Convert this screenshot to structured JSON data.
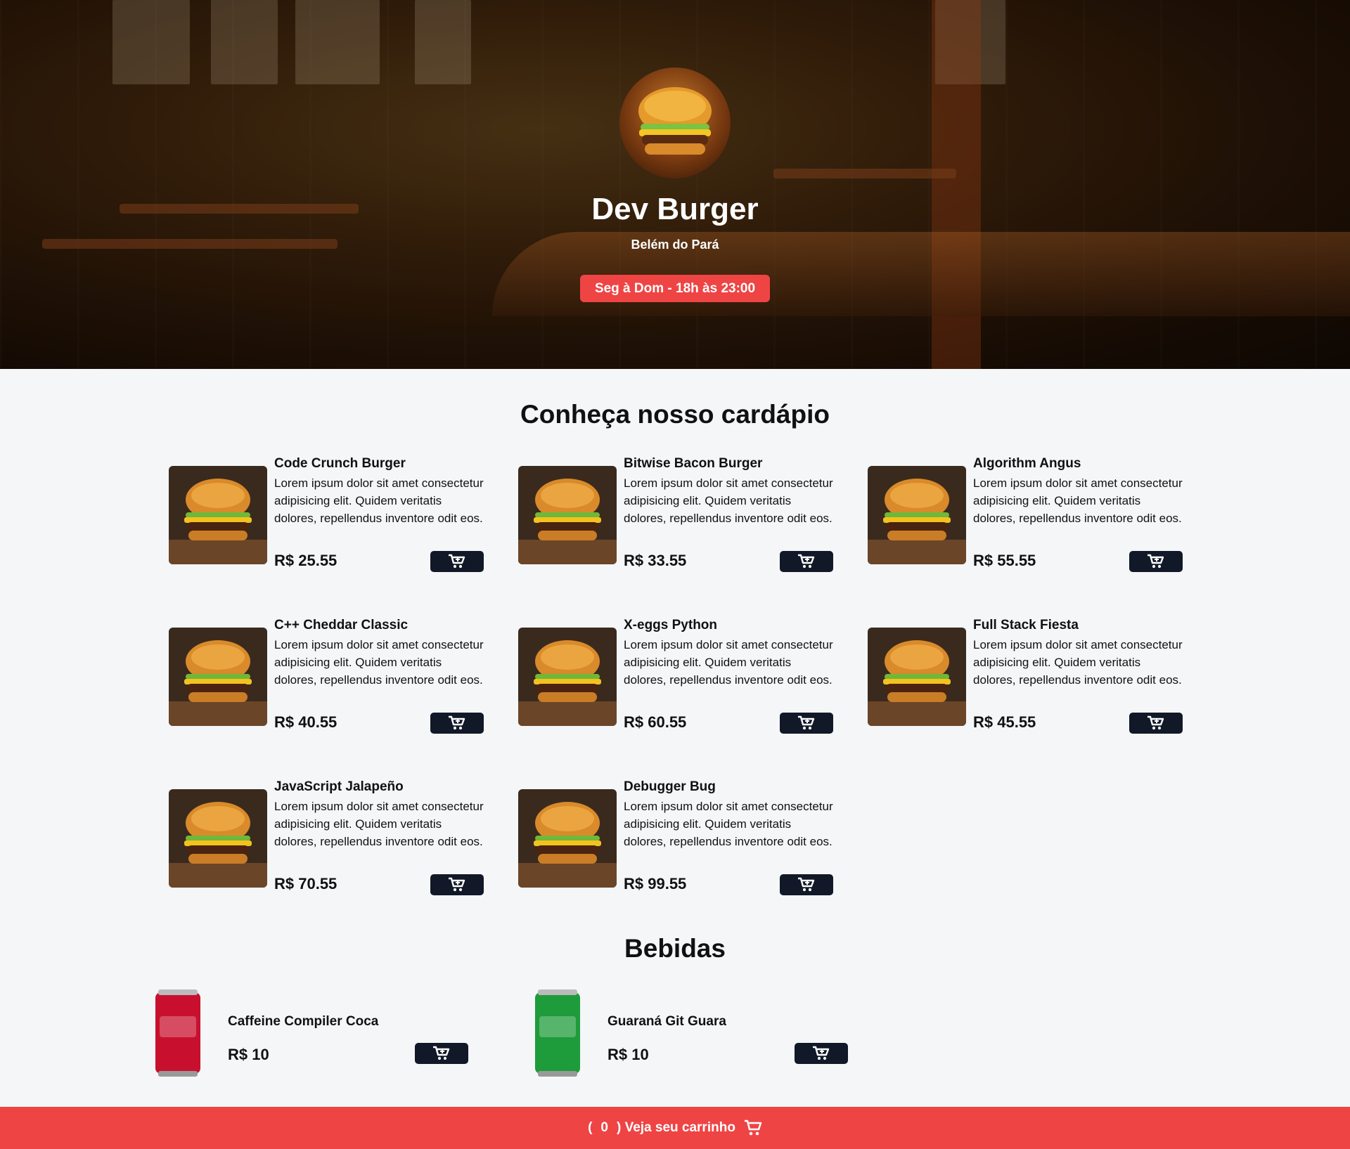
{
  "hero": {
    "title": "Dev Burger",
    "subtitle": "Belém do Pará",
    "hours": "Seg à Dom - 18h às 23:00"
  },
  "menu": {
    "title": "Conheça nosso cardápio",
    "items": [
      {
        "name": "Code Crunch Burger",
        "description": "Lorem ipsum dolor sit amet consectetur adipisicing elit. Quidem veritatis dolores, repellendus inventore odit eos.",
        "price": "R$ 25.55"
      },
      {
        "name": "Bitwise Bacon Burger",
        "description": "Lorem ipsum dolor sit amet consectetur adipisicing elit. Quidem veritatis dolores, repellendus inventore odit eos.",
        "price": "R$ 33.55"
      },
      {
        "name": "Algorithm Angus",
        "description": "Lorem ipsum dolor sit amet consectetur adipisicing elit. Quidem veritatis dolores, repellendus inventore odit eos.",
        "price": "R$ 55.55"
      },
      {
        "name": "C++ Cheddar Classic",
        "description": "Lorem ipsum dolor sit amet consectetur adipisicing elit. Quidem veritatis dolores, repellendus inventore odit eos.",
        "price": "R$ 40.55"
      },
      {
        "name": "X-eggs Python",
        "description": "Lorem ipsum dolor sit amet consectetur adipisicing elit. Quidem veritatis dolores, repellendus inventore odit eos.",
        "price": "R$ 60.55"
      },
      {
        "name": "Full Stack Fiesta",
        "description": "Lorem ipsum dolor sit amet consectetur adipisicing elit. Quidem veritatis dolores, repellendus inventore odit eos.",
        "price": "R$ 45.55"
      },
      {
        "name": "JavaScript Jalapeño",
        "description": "Lorem ipsum dolor sit amet consectetur adipisicing elit. Quidem veritatis dolores, repellendus inventore odit eos.",
        "price": "R$ 70.55"
      },
      {
        "name": "Debugger Bug",
        "description": "Lorem ipsum dolor sit amet consectetur adipisicing elit. Quidem veritatis dolores, repellendus inventore odit eos.",
        "price": "R$ 99.55"
      }
    ]
  },
  "drinks": {
    "title": "Bebidas",
    "items": [
      {
        "name": "Caffeine Compiler Coca",
        "price": "R$ 10",
        "color": "#c8102e"
      },
      {
        "name": "Guaraná Git Guara",
        "price": "R$ 10",
        "color": "#1e9b3a"
      }
    ]
  },
  "footer": {
    "open_paren": "(",
    "count": "0",
    "label": ") Veja seu carrinho"
  },
  "colors": {
    "accent": "#ef4444",
    "button": "#111827",
    "background": "#f4f6f8"
  },
  "icons": {
    "add_to_cart": "cart-plus-icon",
    "footer_cart": "cart-icon"
  }
}
